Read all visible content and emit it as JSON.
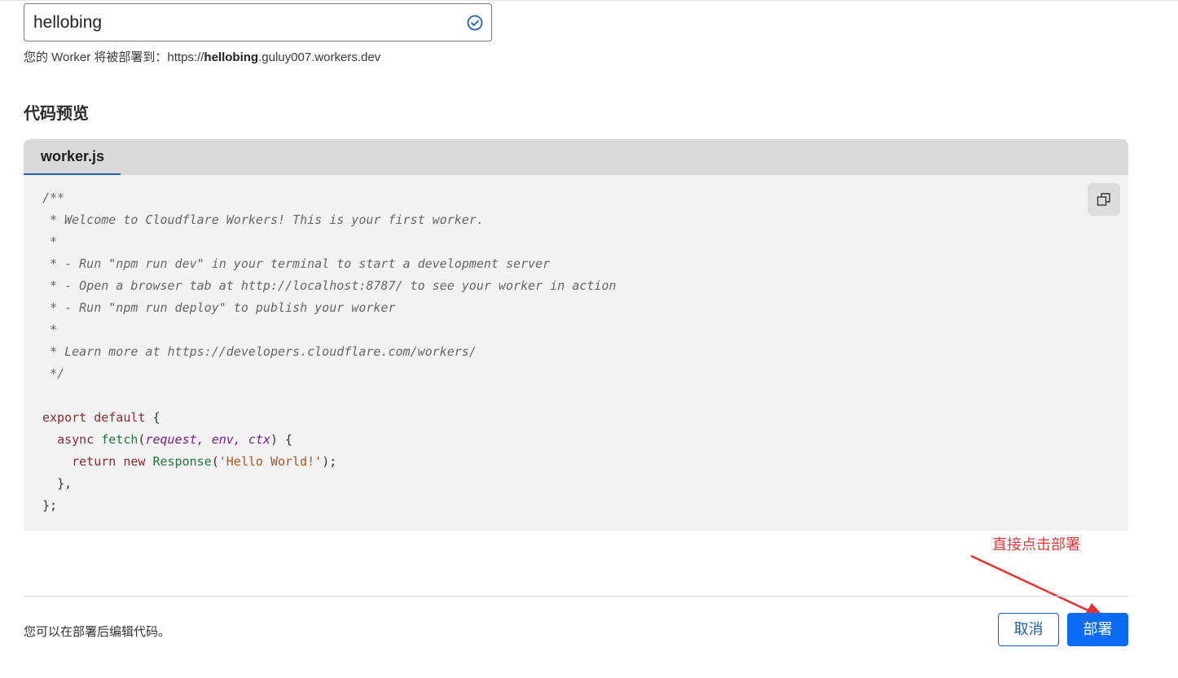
{
  "worker_name": {
    "value": "hellobing"
  },
  "deploy_url": {
    "prefix": "您的 Worker 将被部署到：https://",
    "name": "hellobing",
    "suffix": ".guluy007.workers.dev"
  },
  "section_title": "代码预览",
  "code_preview": {
    "tab_label": "worker.js",
    "lines": {
      "l1": "/**",
      "l2": " * Welcome to Cloudflare Workers! This is your first worker.",
      "l3": " *",
      "l4": " * - Run \"npm run dev\" in your terminal to start a development server",
      "l5": " * - Open a browser tab at http://localhost:8787/ to see your worker in action",
      "l6": " * - Run \"npm run deploy\" to publish your worker",
      "l7": " *",
      "l8": " * Learn more at https://developers.cloudflare.com/workers/",
      "l9": " */",
      "l11_kw": "export default",
      "l11_rest": " {",
      "l12_kw": "async",
      "l12_fn": "fetch",
      "l12_open": "(",
      "l12_params": "request, env, ctx",
      "l12_close": ") {",
      "l13_kw": "return new",
      "l13_fn": "Response",
      "l13_open": "(",
      "l13_str": "'Hello World!'",
      "l13_close": ");",
      "l14": "},",
      "l15": "};"
    }
  },
  "annotation": "直接点击部署",
  "footer": {
    "note": "您可以在部署后编辑代码。",
    "cancel_label": "取消",
    "deploy_label": "部署"
  },
  "icons": {
    "valid": "check-circle-icon",
    "copy": "copy-icon"
  },
  "colors": {
    "primary": "#0a6cf5",
    "annotation": "#e23b3b"
  }
}
